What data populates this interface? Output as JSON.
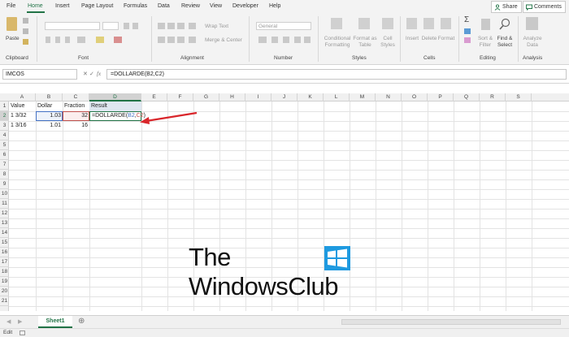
{
  "tabs": [
    "File",
    "Home",
    "Insert",
    "Page Layout",
    "Formulas",
    "Data",
    "Review",
    "View",
    "Developer",
    "Help"
  ],
  "share_label": "Share",
  "comments_label": "Comments",
  "ribbon": {
    "paste": "Paste",
    "clipboard": "Clipboard",
    "font": "Font",
    "alignment": "Alignment",
    "wrap_text": "Wrap Text",
    "merge_center": "Merge & Center",
    "number_format": "General",
    "number": "Number",
    "conditional_formatting": [
      "Conditional",
      "Formatting"
    ],
    "format_as_table": [
      "Format as",
      "Table"
    ],
    "cell_styles": [
      "Cell",
      "Styles"
    ],
    "styles": "Styles",
    "insert": "Insert",
    "delete": "Delete",
    "format": "Format",
    "cells": "Cells",
    "sort_filter": [
      "Sort &",
      "Filter"
    ],
    "find_select": [
      "Find &",
      "Select"
    ],
    "editing": "Editing",
    "analyze_data": [
      "Analyze",
      "Data"
    ],
    "analysis": "Analysis"
  },
  "name_box": "IMCOS",
  "formula_bar": "=DOLLARDE(B2,C2)",
  "column_headers": [
    "A",
    "B",
    "C",
    "D",
    "E",
    "F",
    "G",
    "H",
    "I",
    "J",
    "K",
    "L",
    "M",
    "N",
    "O",
    "P",
    "Q",
    "R",
    "S"
  ],
  "row_headers": [
    "1",
    "2",
    "3",
    "4",
    "5",
    "6",
    "7",
    "8",
    "9",
    "10",
    "11",
    "12",
    "13",
    "14",
    "15",
    "16",
    "17",
    "18",
    "19",
    "20",
    "21"
  ],
  "cells": {
    "A1": "Value",
    "B1": "Dollar",
    "C1": "Fraction",
    "D1": "Result",
    "A2": "1  3/32",
    "B2": "1.03",
    "C2": "32",
    "D2_prefix": "=DOLLARDE(",
    "D2_ref1": "B2",
    "D2_comma": ",",
    "D2_ref2": "C2",
    "D2_suffix": ")",
    "A3": "1  3/16",
    "B3": "1.01",
    "C3": "16"
  },
  "logo": {
    "line1": "The",
    "line2": "WindowsClub"
  },
  "sheet_tab": "Sheet1",
  "status_mode": "Edit",
  "colors": {
    "excel_green": "#217346",
    "ref_blue": "#4472c4",
    "ref_red": "#c0504d",
    "arrow_red": "#d9262b",
    "windows_blue": "#1e9ae0"
  }
}
